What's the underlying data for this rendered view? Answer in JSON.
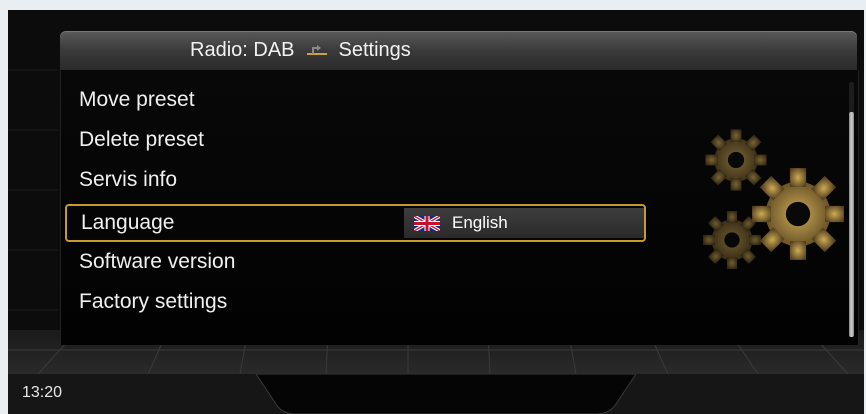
{
  "header": {
    "source": "Radio: DAB",
    "title": "Settings",
    "back_icon": "return-arrow-icon"
  },
  "menu": {
    "items": [
      {
        "label": "Move preset"
      },
      {
        "label": "Delete preset"
      },
      {
        "label": "Servis info"
      },
      {
        "label": "Language",
        "value": "English",
        "value_icon": "uk-flag-icon",
        "selected": true
      },
      {
        "label": "Software version"
      },
      {
        "label": "Factory settings"
      }
    ]
  },
  "status": {
    "time": "13:20"
  },
  "decor": {
    "icon": "gears-icon"
  },
  "colors": {
    "accent": "#c89a2e",
    "header": "#3a3a3a",
    "background": "#0b0b0b",
    "gear": "#b89148"
  }
}
